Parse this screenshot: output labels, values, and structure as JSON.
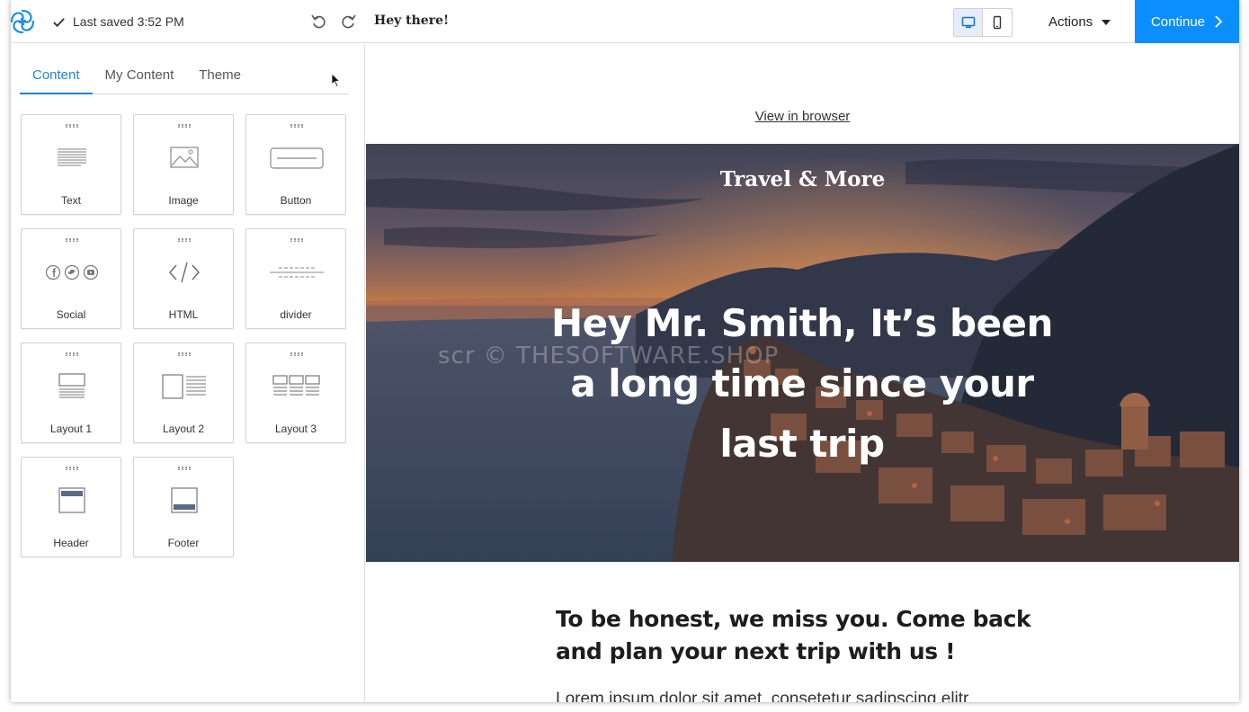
{
  "topbar": {
    "saved_text": "Last saved 3:52 PM",
    "subject": "Hey there!",
    "actions_label": "Actions",
    "continue_label": "Continue"
  },
  "sidebar": {
    "tabs": [
      {
        "label": "Content",
        "active": true
      },
      {
        "label": "My Content",
        "active": false
      },
      {
        "label": "Theme",
        "active": false
      }
    ],
    "blocks": [
      {
        "label": "Text",
        "icon": "text-block-icon"
      },
      {
        "label": "Image",
        "icon": "image-block-icon"
      },
      {
        "label": "Button",
        "icon": "button-block-icon"
      },
      {
        "label": "Social",
        "icon": "social-block-icon"
      },
      {
        "label": "HTML",
        "icon": "html-code-icon"
      },
      {
        "label": "divider",
        "icon": "divider-block-icon"
      },
      {
        "label": "Layout 1",
        "icon": "layout-1-icon"
      },
      {
        "label": "Layout 2",
        "icon": "layout-2-icon"
      },
      {
        "label": "Layout 3",
        "icon": "layout-3-icon"
      },
      {
        "label": "Header",
        "icon": "header-block-icon"
      },
      {
        "label": "Footer",
        "icon": "footer-block-icon"
      }
    ]
  },
  "email": {
    "view_in_browser": "View in browser",
    "brand": "Travel & More",
    "headline": "Hey Mr. Smith, It’s been a long time since your last trip",
    "watermark": "scr © THESOFTWARE.SHOP",
    "subheading": "To be honest, we miss you. Come back and plan your next trip with us !",
    "body_preview": "Lorem ipsum dolor sit amet, consetetur sadipscing elitr,"
  },
  "colors": {
    "accent": "#0b8eff",
    "tab_active": "#1f86d6",
    "logo": "#1a8fe3"
  }
}
